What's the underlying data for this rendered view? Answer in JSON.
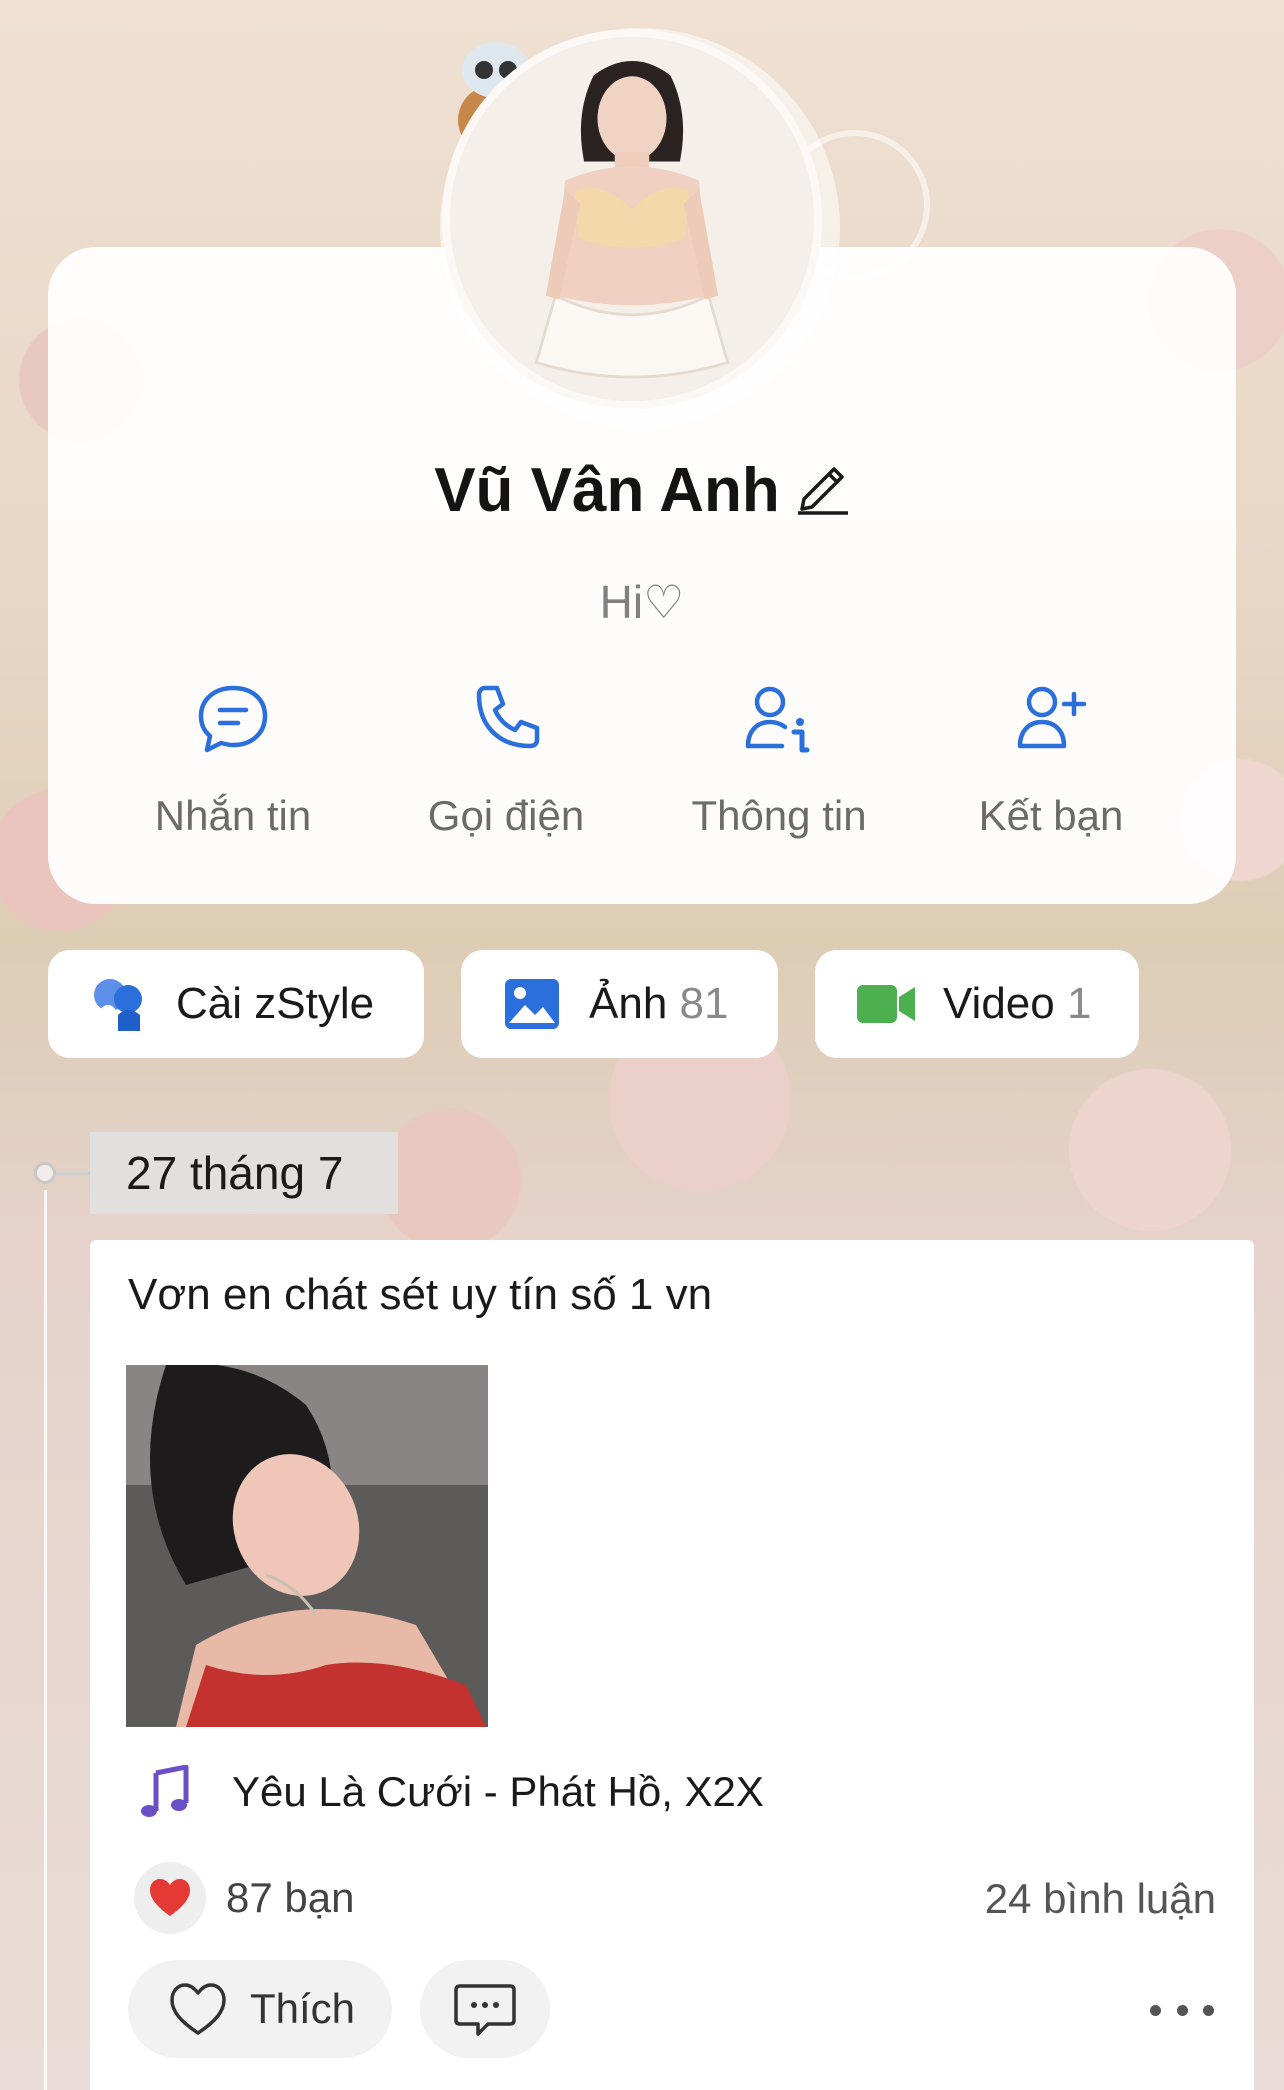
{
  "profile": {
    "name": "Vũ Vân Anh",
    "bio": "Hi♡"
  },
  "actions": [
    {
      "label": "Nhắn tin",
      "icon": "chat-bubble-icon"
    },
    {
      "label": "Gọi điện",
      "icon": "phone-icon"
    },
    {
      "label": "Thông tin",
      "icon": "user-info-icon"
    },
    {
      "label": "Kết bạn",
      "icon": "add-friend-icon"
    }
  ],
  "shortcuts": {
    "zstyle_label": "Cài zStyle",
    "photos_label": "Ảnh",
    "photos_count": "81",
    "video_label": "Video",
    "video_count": "1"
  },
  "timeline": {
    "date": "27 tháng 7"
  },
  "post": {
    "text": "Vơn en chát sét uy tín số 1 vn",
    "music": "Yêu Là Cưới - Phát Hồ, X2X",
    "reactions": "87 bạn",
    "comments": "24 bình luận",
    "like_label": "Thích"
  },
  "colors": {
    "accent": "#2a6fdb",
    "video": "#4caf50",
    "music": "#6a4fc7",
    "heart": "#e53935"
  }
}
